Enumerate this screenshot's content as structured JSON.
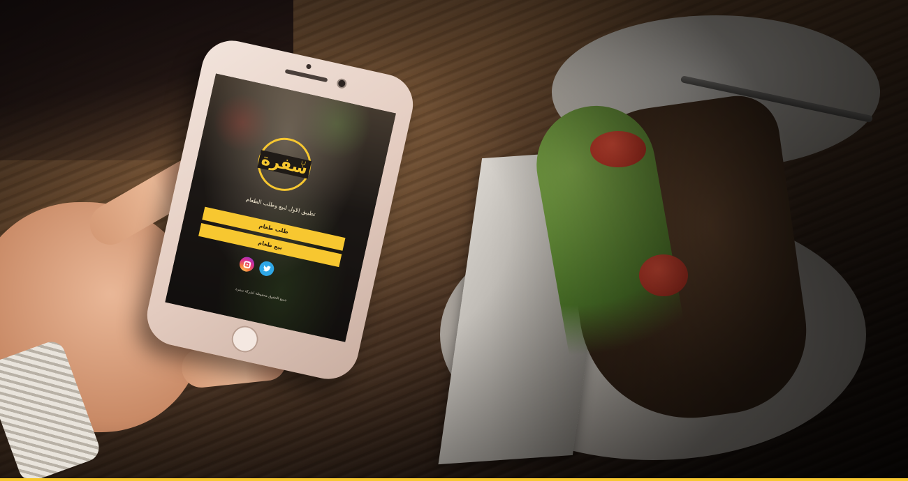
{
  "app": {
    "logo_text": "سفرة",
    "tagline": "تطبيق الاول لبيع وطلب الطعام",
    "buttons": {
      "order_food": "طلب طعام",
      "sell_food": "بيع طعام"
    },
    "social": [
      "instagram-icon",
      "twitter-icon"
    ],
    "footer": "جميع الحقوق محفوظة لشركة سفرة"
  },
  "colors": {
    "accent": "#f7c730",
    "button_text": "#2a1f10",
    "instagram": "#dc2f8d",
    "twitter": "#2fa7e6"
  }
}
